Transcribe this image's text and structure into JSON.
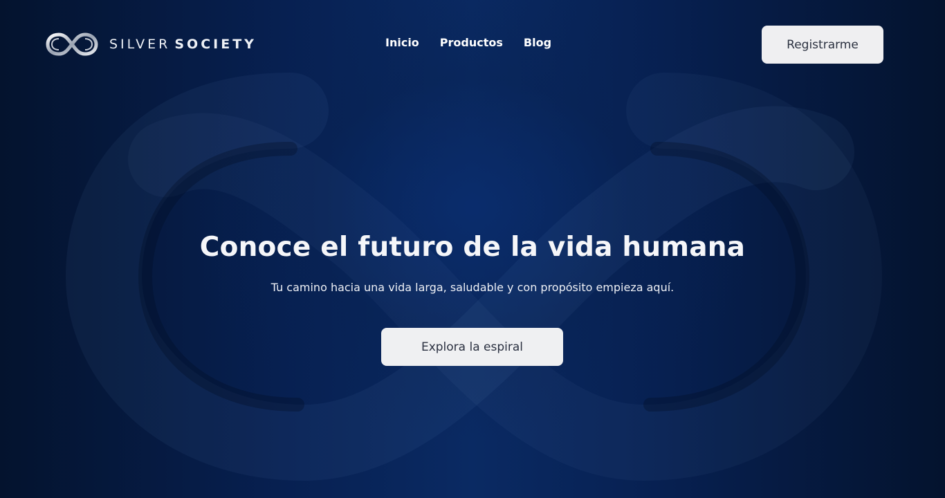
{
  "brand": {
    "name_light": "SILVER",
    "name_bold": "SOCIETY",
    "logo_icon": "infinity-icon"
  },
  "nav": {
    "items": [
      {
        "label": "Inicio"
      },
      {
        "label": "Productos"
      },
      {
        "label": "Blog"
      }
    ]
  },
  "header": {
    "register_label": "Registrarme"
  },
  "hero": {
    "title": "Conoce el futuro de la vida humana",
    "subtitle": "Tu camino hacia una vida larga, saludable y con propósito empieza aquí.",
    "cta_label": "Explora la espiral",
    "background_icon": "infinity-icon"
  },
  "colors": {
    "background": "#061838",
    "accent_blue": "#0a2a63",
    "button_bg": "#efeff1",
    "button_text": "#2b3140"
  }
}
